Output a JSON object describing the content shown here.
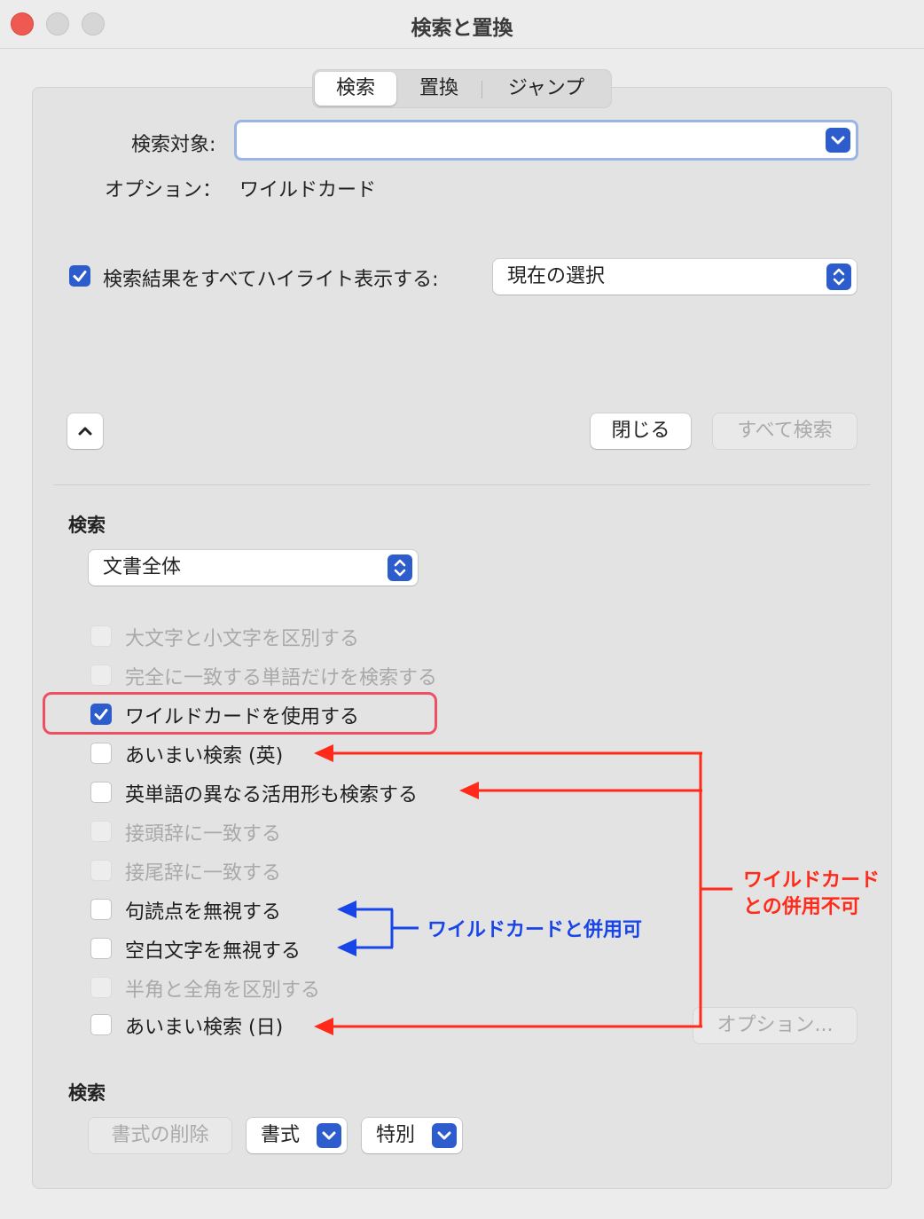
{
  "window": {
    "title": "検索と置換"
  },
  "colors": {
    "accent": "#2d5ccc",
    "annotation_red": "#ff2a1a",
    "annotation_blue": "#1845e8",
    "highlight_box": "#ee4f63"
  },
  "tabs": [
    {
      "label": "検索",
      "selected": true
    },
    {
      "label": "置換",
      "selected": false
    },
    {
      "label": "ジャンプ",
      "selected": false
    }
  ],
  "search": {
    "target_label": "検索対象:",
    "target_value": "",
    "options_label": "オプション：",
    "options_value": "ワイルドカード"
  },
  "highlight": {
    "label": "検索結果をすべてハイライト表示する:",
    "checked": true,
    "scope_value": "現在の選択"
  },
  "buttons": {
    "close": "閉じる",
    "find_all": "すべて検索",
    "options": "オプション...",
    "clear_format": "書式の削除",
    "format": "書式",
    "special": "特別"
  },
  "search_scope": {
    "heading": "検索",
    "value": "文書全体"
  },
  "options": [
    {
      "label": "大文字と小文字を区別する",
      "state": "disabled"
    },
    {
      "label": "完全に一致する単語だけを検索する",
      "state": "disabled"
    },
    {
      "label": "ワイルドカードを使用する",
      "state": "checked"
    },
    {
      "label": "あいまい検索 (英)",
      "state": "unchecked"
    },
    {
      "label": "英単語の異なる活用形も検索する",
      "state": "unchecked"
    },
    {
      "label": "接頭辞に一致する",
      "state": "disabled"
    },
    {
      "label": "接尾辞に一致する",
      "state": "disabled"
    },
    {
      "label": "句読点を無視する",
      "state": "unchecked"
    },
    {
      "label": "空白文字を無視する",
      "state": "unchecked"
    },
    {
      "label": "半角と全角を区別する",
      "state": "disabled"
    },
    {
      "label": "あいまい検索 (日)",
      "state": "unchecked"
    }
  ],
  "format_section": {
    "heading": "検索"
  },
  "annotations": {
    "blue_note": "ワイルドカードと併用可",
    "red_note_line1": "ワイルドカード",
    "red_note_line2": "との併用不可"
  }
}
